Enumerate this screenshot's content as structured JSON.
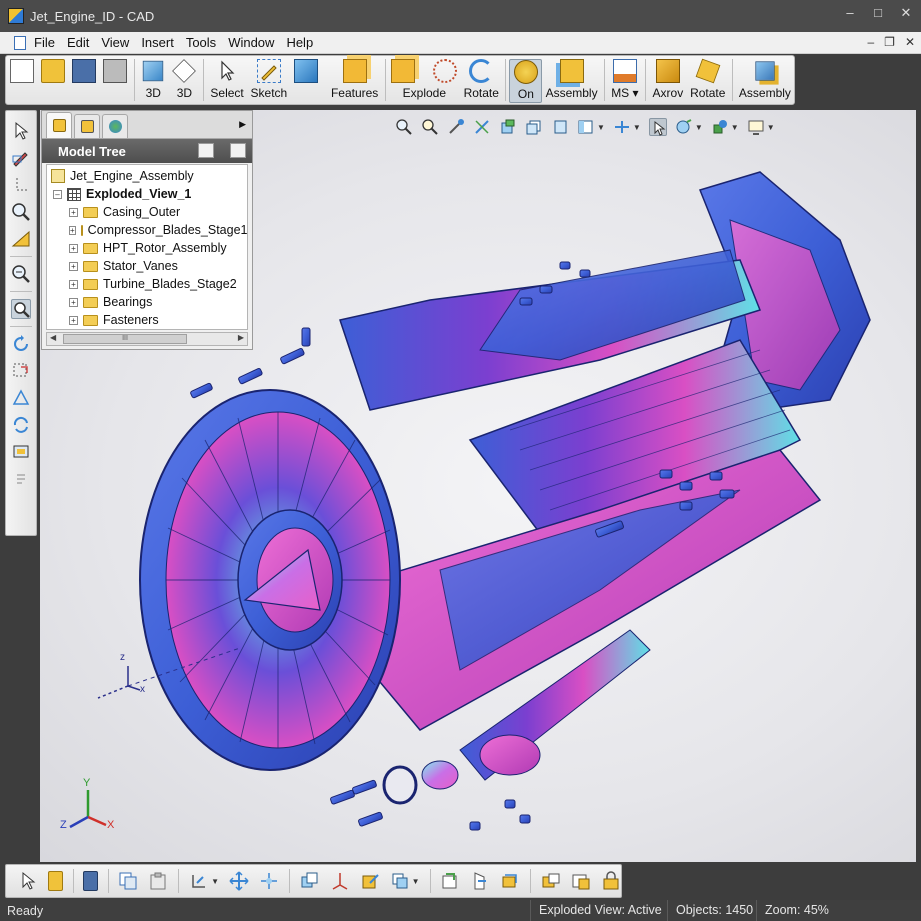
{
  "window": {
    "title": "Jet_Engine_ID - CAD"
  },
  "menu": [
    "File",
    "Edit",
    "View",
    "Insert",
    "Tools",
    "Window",
    "Help"
  ],
  "toolbar": {
    "new_label": "",
    "open_label": "",
    "save_label": "",
    "print_label": "",
    "view3d_a": "3D",
    "view3d_b": "3D",
    "select": "Select",
    "sketch": "Sketch",
    "solid": "",
    "features": "Features",
    "explode_box": "",
    "explode": "Explode",
    "rotate": "Rotate",
    "on": "On",
    "assembly": "Assembly",
    "ms": "MS ▾",
    "axrov": "Axrov",
    "rotate2": "Rotate",
    "assembly2": "Assembly"
  },
  "model_tree": {
    "title": "Model Tree",
    "root": "Jet_Engine_Assembly",
    "view": "Exploded_View_1",
    "items": [
      "Casing_Outer",
      "Compressor_Blades_Stage1",
      "HPT_Rotor_Assembly",
      "Stator_Vanes",
      "Turbine_Blades_Stage2",
      "Bearings",
      "Fasteners"
    ],
    "scroll_grip": "III"
  },
  "viewport": {
    "axis_labels": {
      "x": "X",
      "y": "Y",
      "z": "Z"
    },
    "triad_small": {
      "x": "x",
      "z": "z"
    }
  },
  "status": {
    "ready": "Ready",
    "view_state": "Exploded View: Active",
    "objects": "Objects: 1450",
    "zoom": "Zoom: 45%"
  },
  "colors": {
    "model_blue": "#3d5fd6",
    "model_magenta": "#d94fc4",
    "model_cyan": "#5fe0e6",
    "model_purple": "#7b3fd0"
  }
}
